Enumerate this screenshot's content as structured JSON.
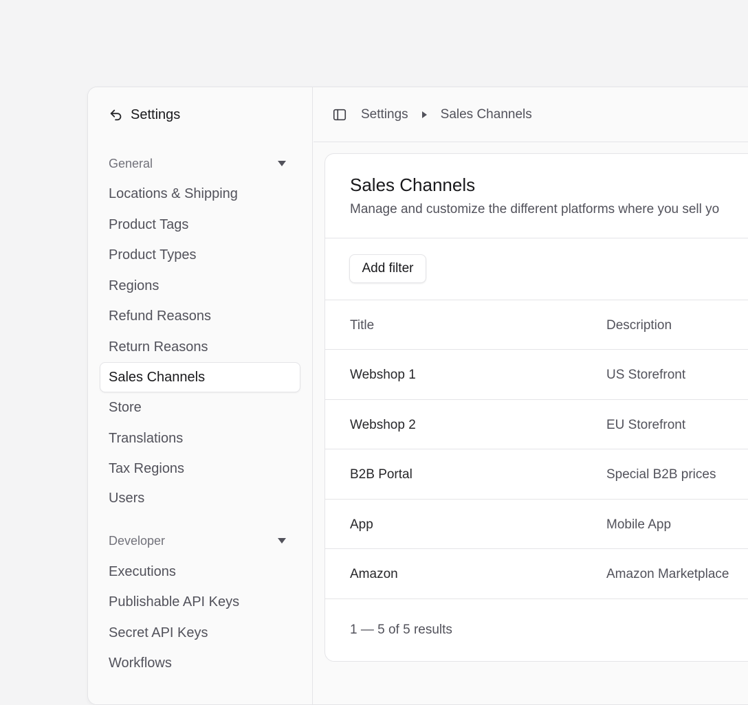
{
  "sidebar": {
    "title": "Settings",
    "back_icon": "back-arrow-icon",
    "general_label": "General",
    "general_items": [
      "Locations & Shipping",
      "Product Tags",
      "Product Types",
      "Regions",
      "Refund Reasons",
      "Return Reasons",
      "Sales Channels",
      "Store",
      "Translations",
      "Tax Regions",
      "Users"
    ],
    "developer_label": "Developer",
    "developer_items": [
      "Executions",
      "Publishable API Keys",
      "Secret API Keys",
      "Workflows"
    ],
    "active_item": "Sales Channels"
  },
  "topbar": {
    "toggle_icon": "sidebar-toggle-icon",
    "breadcrumb": [
      "Settings",
      "Sales Channels"
    ]
  },
  "main": {
    "title": "Sales Channels",
    "description": "Manage and customize the different platforms where you sell yo",
    "add_filter_label": "Add filter",
    "columns": [
      "Title",
      "Description"
    ],
    "rows": [
      {
        "title": "Webshop 1",
        "description": "US Storefront"
      },
      {
        "title": "Webshop 2",
        "description": "EU Storefront"
      },
      {
        "title": "B2B Portal",
        "description": "Special B2B prices"
      },
      {
        "title": "App",
        "description": "Mobile App"
      },
      {
        "title": "Amazon",
        "description": "Amazon Marketplace"
      }
    ],
    "pagination": "1 — 5 of 5 results"
  }
}
